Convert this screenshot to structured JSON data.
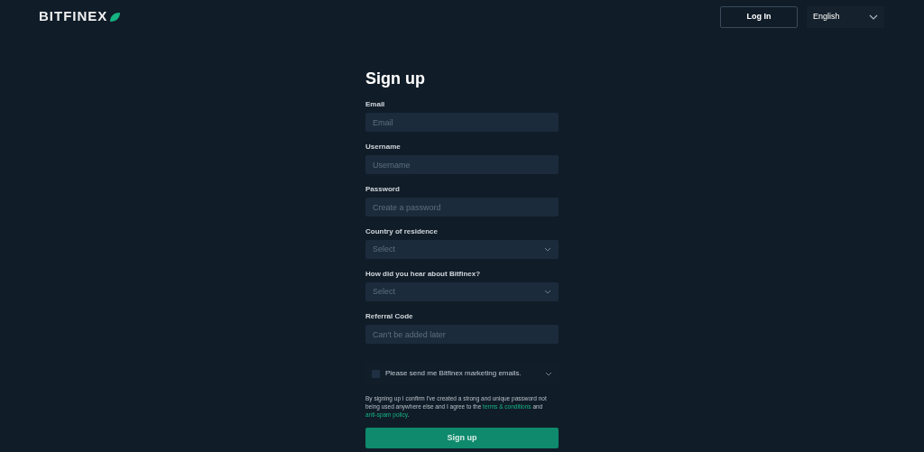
{
  "header": {
    "logo": "BITFINEX",
    "login_button": "Log In",
    "language": "English"
  },
  "form": {
    "title": "Sign up",
    "fields": [
      {
        "kind": "input",
        "label": "Email",
        "placeholder": "Email"
      },
      {
        "kind": "input",
        "label": "Username",
        "placeholder": "Username"
      },
      {
        "kind": "input",
        "label": "Password",
        "placeholder": "Create a password"
      },
      {
        "kind": "select",
        "label": "Country of residence",
        "placeholder": "Select"
      },
      {
        "kind": "select",
        "label": "How did you hear about Bitfinex?",
        "placeholder": "Select"
      },
      {
        "kind": "input",
        "label": "Referral Code",
        "placeholder": "Can't be added later"
      }
    ],
    "marketing": {
      "label": "Please send me Bitfinex marketing emails.",
      "checked": false
    },
    "terms": [
      {
        "kind": "text",
        "text": "By signing up I confirm I've created a strong and unique password not being used anywhere else and I agree to the"
      },
      {
        "kind": "link",
        "text": "terms & conditions"
      },
      {
        "kind": "text",
        "text": "and"
      },
      {
        "kind": "link",
        "text": "anti-spam policy"
      },
      {
        "kind": "text",
        "text": "."
      }
    ],
    "submit": "Sign up"
  }
}
